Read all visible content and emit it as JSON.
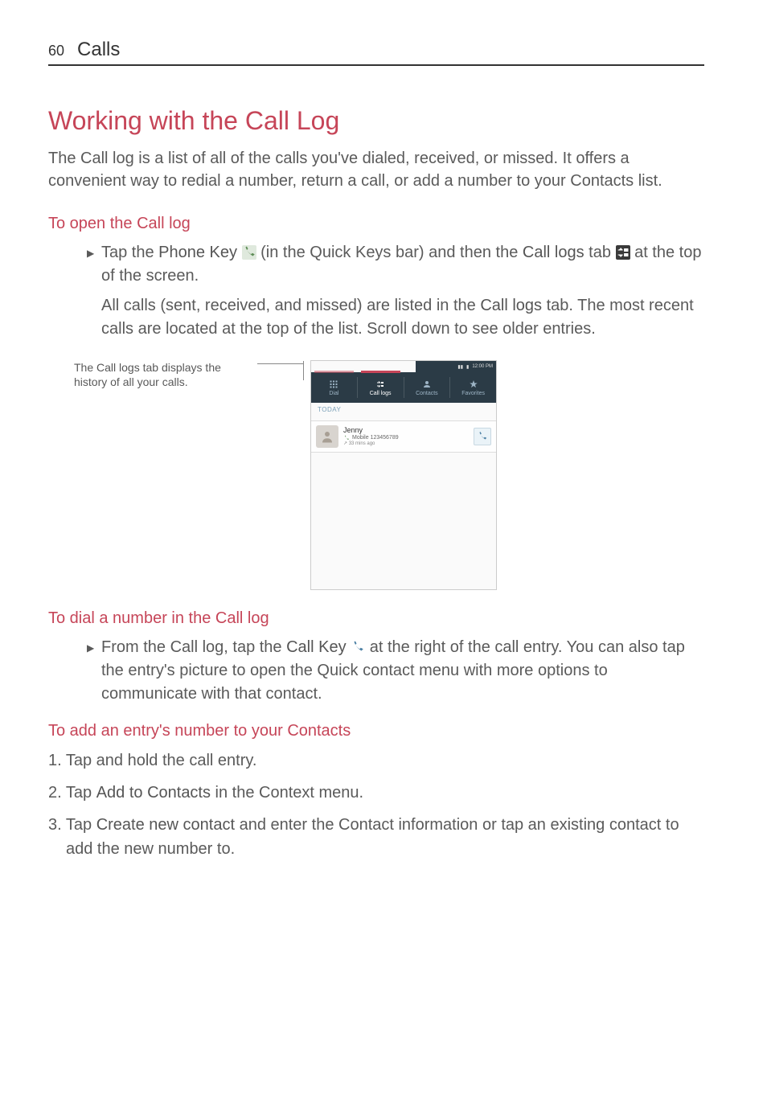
{
  "header": {
    "page_number": "60",
    "section": "Calls"
  },
  "title": "Working with the Call Log",
  "intro": "The Call log is a list of all of the calls you've dialed, received, or missed. It offers a convenient way to redial a number, return a call, or add a number to your Contacts list.",
  "open_section": {
    "heading": "To open the Call log",
    "bullet_pre": "Tap the ",
    "phone_key_bold": "Phone Key",
    "bullet_mid1": " (in the Quick Keys bar) and then the ",
    "call_logs_bold": "Call logs",
    "bullet_mid2": " tab ",
    "bullet_tail": " at the top of the screen.",
    "para2_pre": "All calls (sent, received, and missed) are listed in the ",
    "para2_bold": "Call logs",
    "para2_tail": " tab. The most recent calls are located at the top of the list. Scroll down to see older entries."
  },
  "caption": {
    "pre": "The ",
    "bold": "Call logs",
    "post": " tab displays the history of all your calls."
  },
  "screenshot": {
    "status_time": "12:00 PM",
    "tabs": {
      "dial": "Dial",
      "call_logs": "Call logs",
      "contacts": "Contacts",
      "favorites": "Favorites"
    },
    "today_label": "TODAY",
    "entry": {
      "name": "Jenny",
      "detail": "Mobile 123456789",
      "time": "33 mins ago"
    }
  },
  "dial_section": {
    "heading": "To dial a number in the Call log",
    "bullet_pre": "From the Call log, tap the ",
    "bold": "Call Key",
    "bullet_tail": " at the right of the call entry. You can also tap the entry's picture to open the Quick contact menu with more options to communicate with that contact."
  },
  "add_section": {
    "heading": "To add an entry's number to your Contacts",
    "step1": "1. Tap and hold the call entry.",
    "step2_pre": "2. Tap ",
    "step2_bold": "Add to Contacts",
    "step2_post": " in the Context menu.",
    "step3_pre": "3. Tap ",
    "step3_bold": "Create new contact",
    "step3_post": " and enter the Contact information or tap an existing contact to add the new number to."
  }
}
